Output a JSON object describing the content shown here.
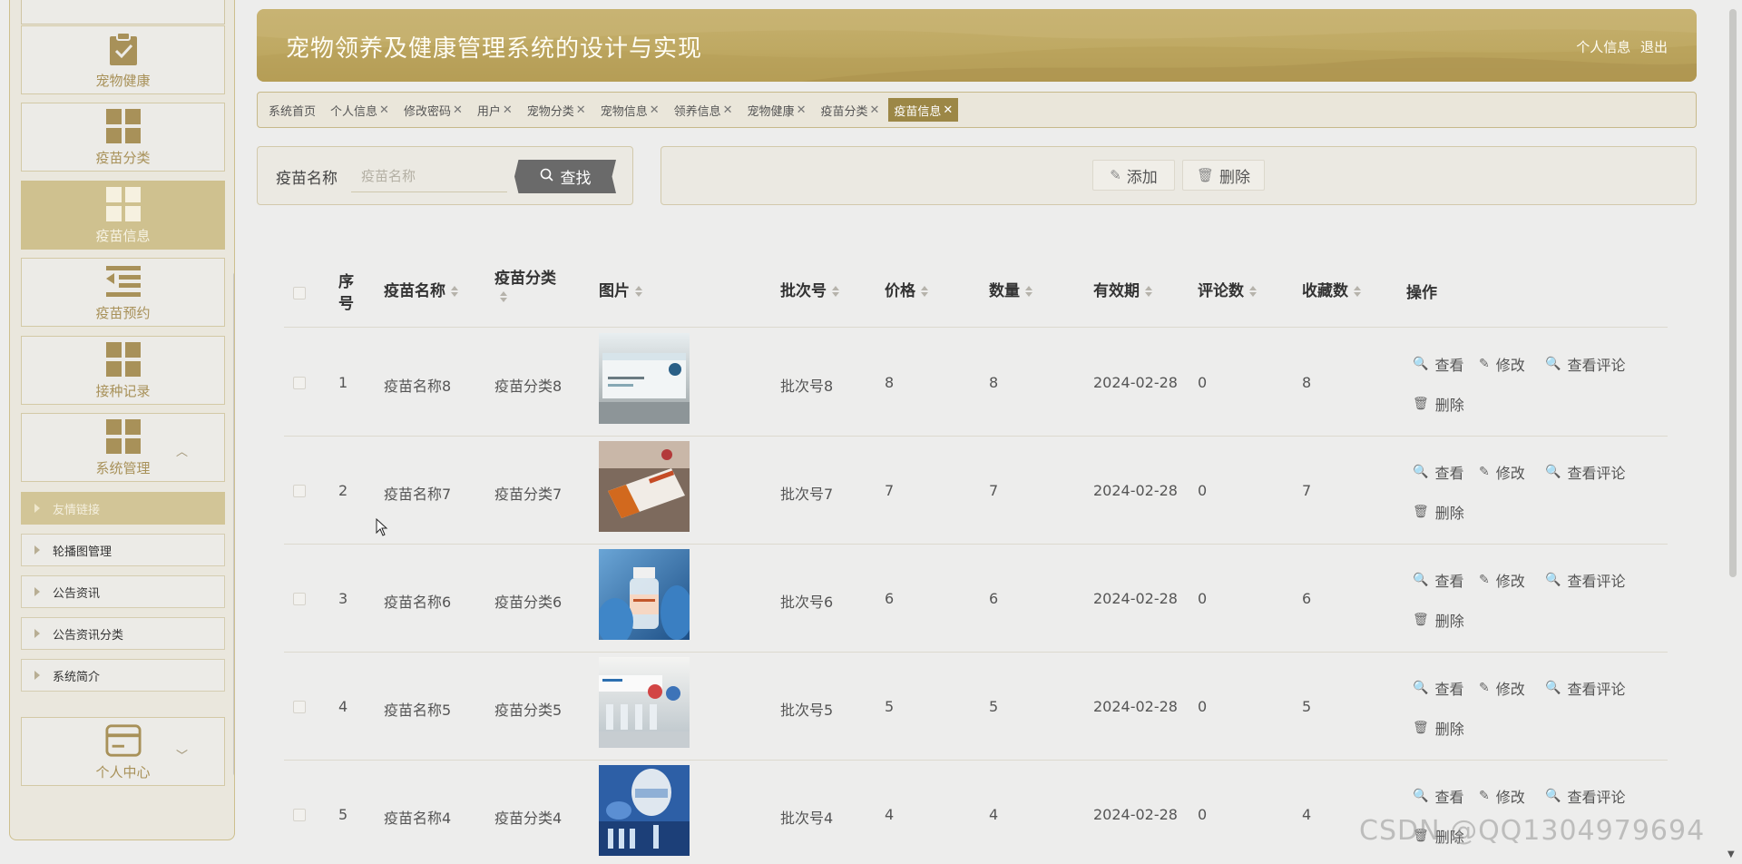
{
  "header": {
    "title": "宠物领养及健康管理系统的设计与实现",
    "profile_link": "个人信息",
    "logout_link": "退出"
  },
  "sidebar": {
    "items": [
      {
        "label": "宠物健康",
        "icon": "clipboard-check-icon"
      },
      {
        "label": "疫苗分类",
        "icon": "grid-icon"
      },
      {
        "label": "疫苗信息",
        "icon": "grid-icon"
      },
      {
        "label": "疫苗预约",
        "icon": "list-icon"
      },
      {
        "label": "接种记录",
        "icon": "grid-icon"
      },
      {
        "label": "系统管理",
        "icon": "grid-icon"
      },
      {
        "label": "个人中心",
        "icon": "card-icon"
      }
    ],
    "submenu": [
      "友情链接",
      "轮播图管理",
      "公告资讯",
      "公告资讯分类",
      "系统简介"
    ]
  },
  "tabs": [
    {
      "label": "系统首页",
      "closable": false
    },
    {
      "label": "个人信息",
      "closable": true
    },
    {
      "label": "修改密码",
      "closable": true
    },
    {
      "label": "用户",
      "closable": true
    },
    {
      "label": "宠物分类",
      "closable": true
    },
    {
      "label": "宠物信息",
      "closable": true
    },
    {
      "label": "领养信息",
      "closable": true
    },
    {
      "label": "宠物健康",
      "closable": true
    },
    {
      "label": "疫苗分类",
      "closable": true
    },
    {
      "label": "疫苗信息",
      "closable": true
    }
  ],
  "active_tab": "疫苗信息",
  "search": {
    "label": "疫苗名称",
    "placeholder": "疫苗名称",
    "value": "",
    "button": "查找"
  },
  "actions": {
    "add": "添加",
    "delete": "删除"
  },
  "table": {
    "headers": {
      "index": "序号",
      "name": "疫苗名称",
      "category": "疫苗分类",
      "image": "图片",
      "batch": "批次号",
      "price": "价格",
      "quantity": "数量",
      "expiry": "有效期",
      "comments": "评论数",
      "favorites": "收藏数",
      "ops": "操作"
    },
    "op_labels": {
      "view": "查看",
      "edit": "修改",
      "view_comments": "查看评论",
      "delete": "删除"
    },
    "rows": [
      {
        "index": "1",
        "name": "疫苗名称8",
        "category": "疫苗分类8",
        "batch": "批次号8",
        "price": "8",
        "quantity": "8",
        "expiry": "2024-02-28",
        "comments": "0",
        "favorites": "8"
      },
      {
        "index": "2",
        "name": "疫苗名称7",
        "category": "疫苗分类7",
        "batch": "批次号7",
        "price": "7",
        "quantity": "7",
        "expiry": "2024-02-28",
        "comments": "0",
        "favorites": "7"
      },
      {
        "index": "3",
        "name": "疫苗名称6",
        "category": "疫苗分类6",
        "batch": "批次号6",
        "price": "6",
        "quantity": "6",
        "expiry": "2024-02-28",
        "comments": "0",
        "favorites": "6"
      },
      {
        "index": "4",
        "name": "疫苗名称5",
        "category": "疫苗分类5",
        "batch": "批次号5",
        "price": "5",
        "quantity": "5",
        "expiry": "2024-02-28",
        "comments": "0",
        "favorites": "5"
      },
      {
        "index": "5",
        "name": "疫苗名称4",
        "category": "疫苗分类4",
        "batch": "批次号4",
        "price": "4",
        "quantity": "4",
        "expiry": "2024-02-28",
        "comments": "0",
        "favorites": "4"
      }
    ]
  },
  "watermark": "CSDN @QQ1304979694",
  "colors": {
    "accent": "#bfa963",
    "active_tab": "#9c8746",
    "sidebar_active": "#cfc18f"
  }
}
